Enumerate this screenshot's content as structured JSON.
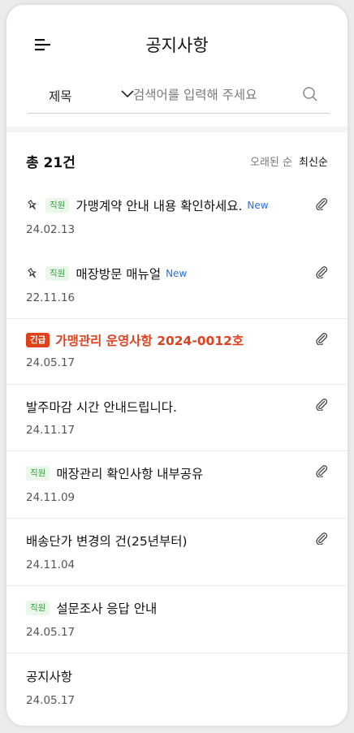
{
  "header": {
    "title": "공지사항",
    "menu_icon": "menu-icon"
  },
  "search": {
    "field_select": "제목",
    "placeholder": "검색어를 입력해 주세요",
    "value": ""
  },
  "list_header": {
    "count": "총 21건",
    "sort_oldest": "오래된 순",
    "sort_newest": "최신순",
    "active_sort": "최신순"
  },
  "colors": {
    "urgent": "#e0401c",
    "staff_badge": "#3a9b44",
    "new_tag": "#2f6fd8"
  },
  "notices": [
    {
      "pinned": true,
      "staff": true,
      "urgent": false,
      "title": "가맹계약 안내 내용 확인하세요.",
      "new": "New",
      "date": "24.02.13",
      "attachment": true
    },
    {
      "pinned": true,
      "staff": true,
      "urgent": false,
      "title": "매장방문 매뉴얼",
      "new": "New",
      "date": "22.11.16",
      "attachment": true
    },
    {
      "pinned": false,
      "staff": false,
      "urgent": true,
      "urgent_label": "긴급",
      "title": "가맹관리 운영사항 2024-0012호",
      "date": "24.05.17",
      "attachment": true
    },
    {
      "pinned": false,
      "staff": false,
      "urgent": false,
      "title": "발주마감 시간 안내드립니다.",
      "date": "24.11.17",
      "attachment": true
    },
    {
      "pinned": false,
      "staff": true,
      "urgent": false,
      "title": "매장관리 확인사항 내부공유",
      "date": "24.11.09",
      "attachment": true
    },
    {
      "pinned": false,
      "staff": false,
      "urgent": false,
      "title": "배송단가 변경의 건(25년부터)",
      "date": "24.11.04",
      "attachment": true
    },
    {
      "pinned": false,
      "staff": true,
      "urgent": false,
      "title": "설문조사 응답 안내",
      "date": "24.05.17",
      "attachment": false
    },
    {
      "pinned": false,
      "staff": false,
      "urgent": false,
      "title": "공지사항",
      "date": "24.05.17",
      "attachment": false
    }
  ],
  "staff_label": "직원"
}
